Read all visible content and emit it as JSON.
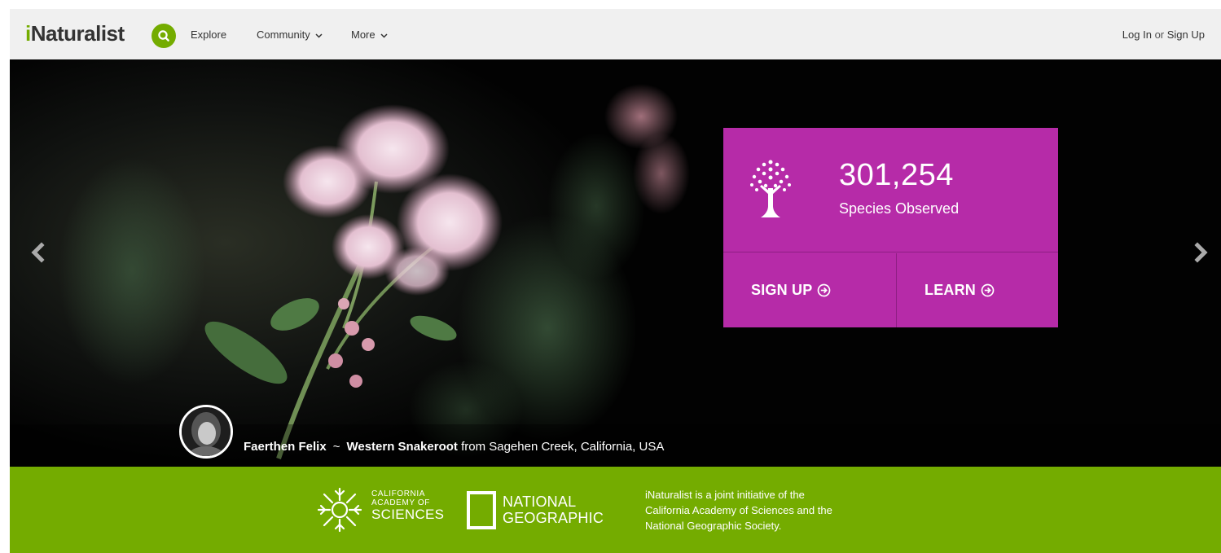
{
  "header": {
    "logo_prefix": "i",
    "logo_rest": "Naturalist",
    "nav": {
      "explore": "Explore",
      "community": "Community",
      "more": "More"
    },
    "auth": {
      "login": "Log In",
      "or": "or",
      "signup": "Sign Up"
    }
  },
  "hero": {
    "stat_number": "301,254",
    "stat_label": "Species Observed",
    "signup_button": "SIGN UP",
    "learn_button": "LEARN",
    "caption": {
      "observer": "Faerthen Felix",
      "separator": "~",
      "species": "Western Snakeroot",
      "location": "from Sagehen Creek, California, USA"
    }
  },
  "partners": {
    "cas_line1": "CALIFORNIA",
    "cas_line2": "ACADEMY OF",
    "cas_line3": "SCIENCES",
    "ng_line1": "NATIONAL",
    "ng_line2": "GEOGRAPHIC",
    "blurb_line1": "iNaturalist is a joint initiative of the",
    "blurb_line2": "California Academy of Sciences and the",
    "blurb_line3": "National Geographic Society."
  },
  "colors": {
    "brand_green": "#74ac00",
    "stat_magenta": "#b62ba8",
    "nav_bg": "#f0f0f0"
  },
  "icons": {
    "search": "search-icon",
    "chevron": "chevron-down-icon",
    "prev": "chevron-left-icon",
    "next": "chevron-right-icon",
    "tree": "tree-icon",
    "arrow_circle": "arrow-circle-right-icon"
  }
}
